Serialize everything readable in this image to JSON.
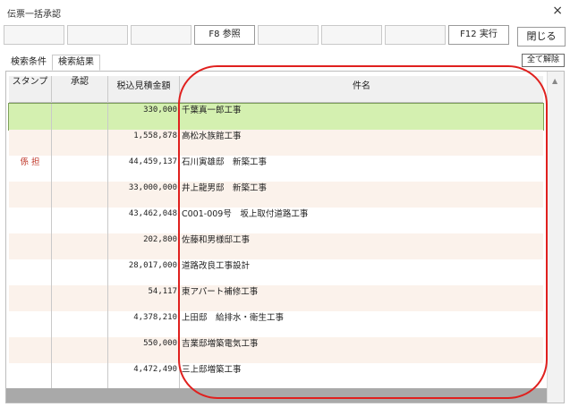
{
  "window": {
    "title": "伝票一括承認",
    "close_glyph": "×"
  },
  "fkeys": [
    {
      "label": ""
    },
    {
      "label": ""
    },
    {
      "label": ""
    },
    {
      "label": "F8 参照"
    },
    {
      "label": ""
    },
    {
      "label": ""
    },
    {
      "label": ""
    },
    {
      "label": "F12 実行"
    }
  ],
  "close_button": "閉じる",
  "tabs": [
    {
      "label": "検索条件"
    },
    {
      "label": "検索結果"
    }
  ],
  "clear_button": "全て解除",
  "columns": {
    "stamp": "スタンプ",
    "approval": "承認",
    "amount": "税込見積金額",
    "name": "件名"
  },
  "rows": [
    {
      "stamp": "",
      "amount": "330,000",
      "name": "千葉真一郎工事",
      "highlight": true
    },
    {
      "stamp": "",
      "amount": "1,558,878",
      "name": "高松水族館工事"
    },
    {
      "stamp": "係 担",
      "amount": "44,459,137",
      "name": "石川寅雄邸　新築工事"
    },
    {
      "stamp": "",
      "amount": "33,000,000",
      "name": "井上龍男邸　新築工事"
    },
    {
      "stamp": "",
      "amount": "43,462,048",
      "name": "C001-009号　坂上取付道路工事"
    },
    {
      "stamp": "",
      "amount": "202,800",
      "name": "佐藤和男様邸工事"
    },
    {
      "stamp": "",
      "amount": "28,017,000",
      "name": "道路改良工事設計"
    },
    {
      "stamp": "",
      "amount": "54,117",
      "name": "東アパート補修工事"
    },
    {
      "stamp": "",
      "amount": "4,378,210",
      "name": "上田邸　給排水・衛生工事"
    },
    {
      "stamp": "",
      "amount": "550,000",
      "name": "吉業邸増築電気工事"
    },
    {
      "stamp": "",
      "amount": "4,472,490",
      "name": "三上邸増築工事"
    }
  ],
  "colors": {
    "row_alt": "#fbf2eb",
    "row_highlight": "#d4f0b0",
    "annotation": "#e0201e"
  }
}
